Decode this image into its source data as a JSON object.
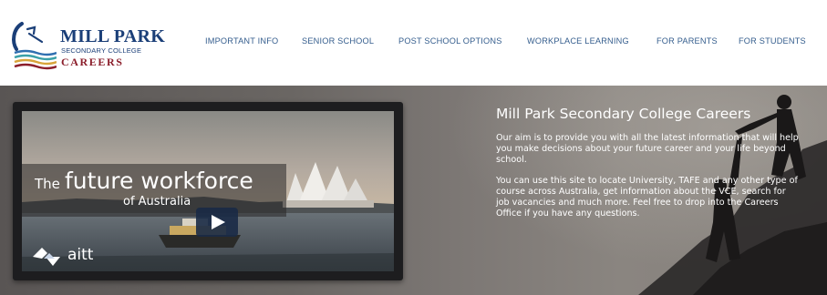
{
  "logo": {
    "line1": "MILL PARK",
    "line2": "SECONDARY COLLEGE",
    "line3": "CAREERS"
  },
  "nav": [
    {
      "label": "IMPORTANT INFO"
    },
    {
      "label": "SENIOR SCHOOL"
    },
    {
      "label": "POST SCHOOL OPTIONS"
    },
    {
      "label": "WORKPLACE LEARNING"
    },
    {
      "label": "FOR PARENTS"
    },
    {
      "label": "FOR STUDENTS"
    }
  ],
  "video": {
    "caption_prefix": "The",
    "caption_main": "future workforce",
    "caption_sub": "of Australia",
    "brand": "aitt",
    "play_icon": "play-icon"
  },
  "hero": {
    "title": "Mill Park Secondary College Careers",
    "paragraph1": "Our aim is to provide you with all the latest information that will help you make decisions about your future career and your life beyond school.",
    "paragraph2": "You can use this site to locate University, TAFE and any other type of course across Australia, get information about the VCE, search for job vacancies and much more. Feel free to drop into the Careers Office if you have any questions."
  },
  "colors": {
    "brand_blue": "#1b3f78",
    "brand_red": "#8b1e2b",
    "nav_text": "#345d8d"
  }
}
